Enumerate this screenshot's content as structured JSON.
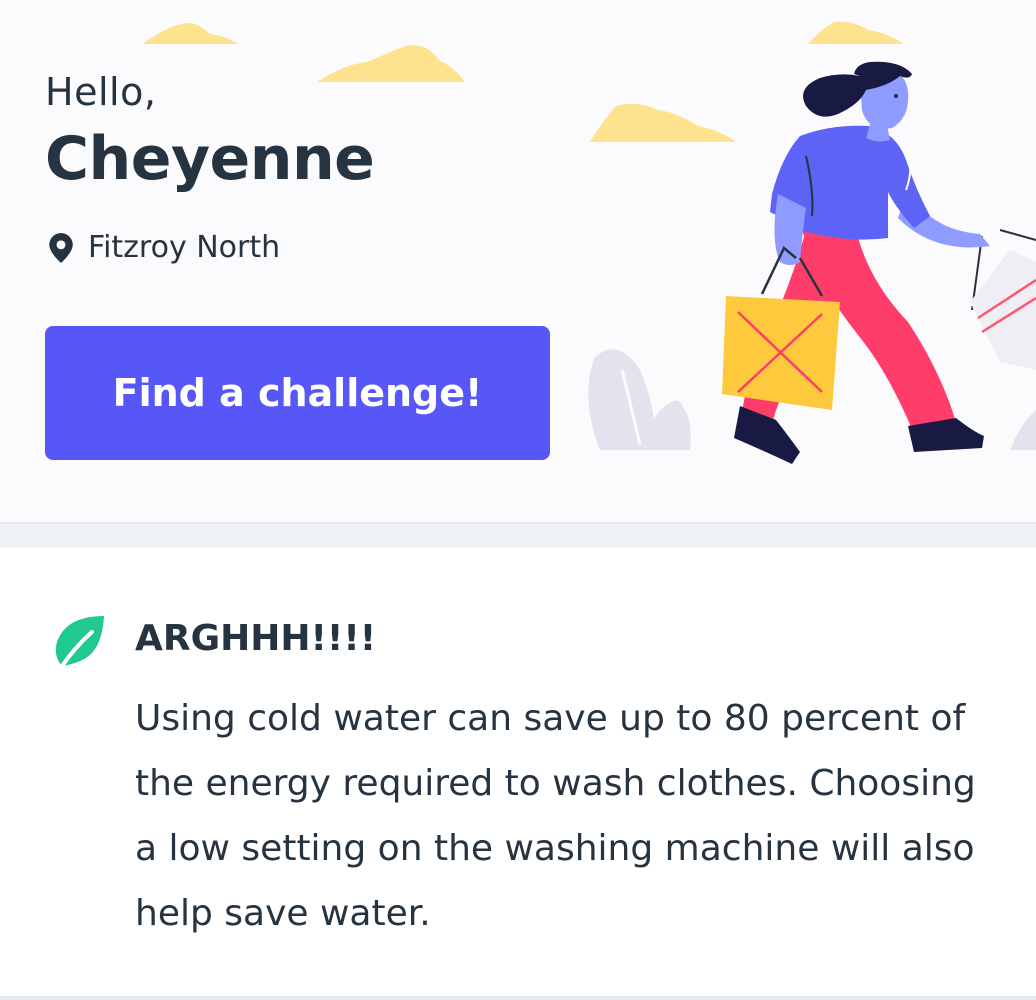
{
  "hero": {
    "greeting": "Hello,",
    "user_name": "Cheyenne",
    "location": "Fitzroy North",
    "cta_label": "Find a challenge!",
    "location_icon": "map-pin-icon",
    "illustration": "woman-with-shopping-bags"
  },
  "tip": {
    "icon": "leaf-icon",
    "title": "ARGHHH!!!!",
    "body": "Using cold water can save up to 80 percent of the energy required to wash clothes. Choosing a low setting on the washing machine will also help save water."
  },
  "colors": {
    "primary": "#5757f8",
    "text": "#263340",
    "leaf": "#22c98f",
    "cloud": "#fde38e",
    "hero_background": "#fbfbfd",
    "divider": "#eef1f5"
  }
}
